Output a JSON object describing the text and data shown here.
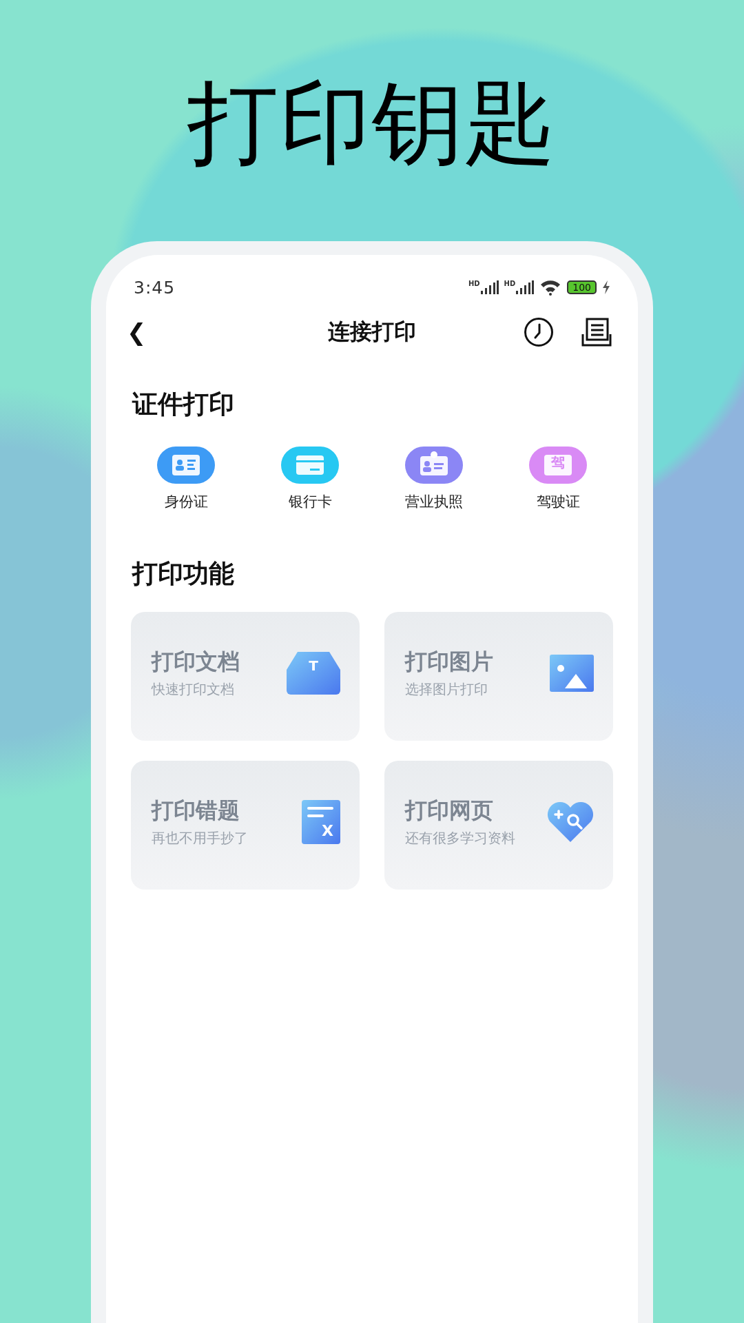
{
  "headline": "打印钥匙",
  "status_bar": {
    "time": "3:45",
    "sim_labels": [
      "HD",
      "HD"
    ],
    "battery": "100",
    "charging": true
  },
  "nav": {
    "back": "❮",
    "title": "连接打印"
  },
  "id_section": {
    "title": "证件打印",
    "items": [
      {
        "label": "身份证",
        "kind": "idcard",
        "color": "#3d9bf5"
      },
      {
        "label": "银行卡",
        "kind": "bankcard",
        "color": "#27c8f2"
      },
      {
        "label": "营业执照",
        "kind": "badge",
        "color": "#8b86f5"
      },
      {
        "label": "驾驶证",
        "kind": "licence",
        "color": "#d98af5",
        "glyph": "驾"
      }
    ]
  },
  "func_section": {
    "title": "打印功能",
    "cards": [
      {
        "title": "打印文档",
        "subtitle": "快速打印文档",
        "kind": "document",
        "glyph": "T"
      },
      {
        "title": "打印图片",
        "subtitle": "选择图片打印",
        "kind": "image"
      },
      {
        "title": "打印错题",
        "subtitle": "再也不用手抄了",
        "kind": "mistakes",
        "glyph": "X"
      },
      {
        "title": "打印网页",
        "subtitle": "还有很多学习资料",
        "kind": "web"
      }
    ]
  }
}
